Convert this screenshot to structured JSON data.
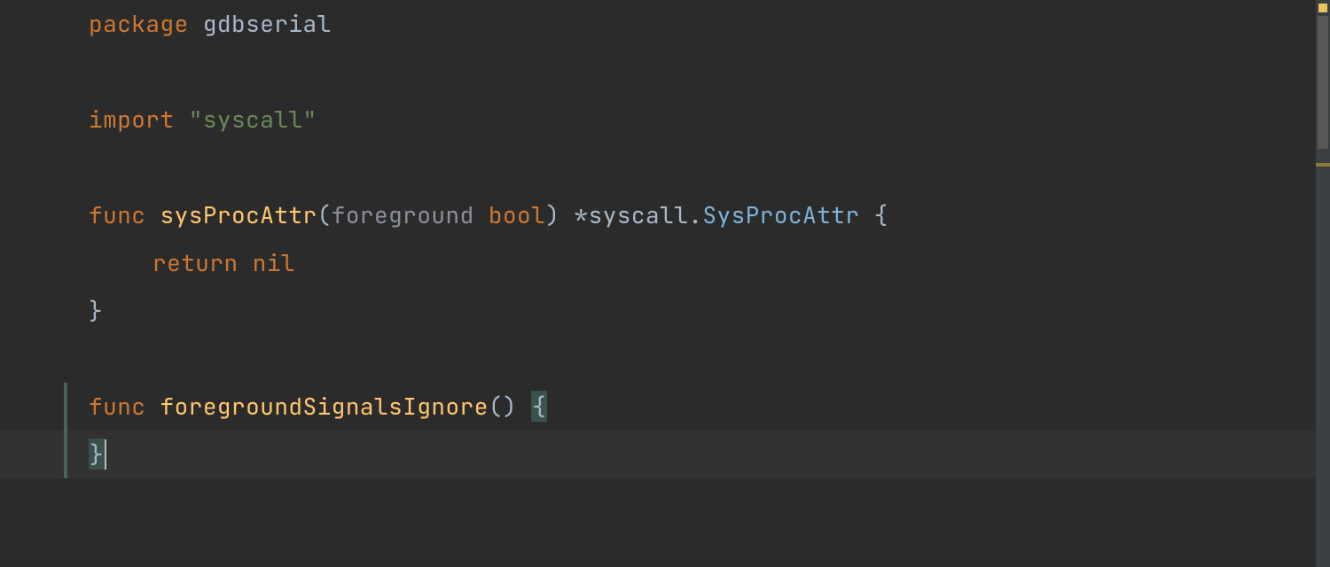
{
  "code": {
    "line1": {
      "kw_package": "package",
      "pkg_name": "gdbserial"
    },
    "line3": {
      "kw_import": "import",
      "import_path": "\"syscall\""
    },
    "line5": {
      "kw_func": "func",
      "fn_name": "sysProcAttr",
      "paren_open": "(",
      "param_name": "foreground",
      "param_type": "bool",
      "paren_close": ")",
      "star": "*",
      "ret_pkg": "syscall",
      "dot": ".",
      "ret_type": "SysProcAttr",
      "brace_open": "{"
    },
    "line6": {
      "kw_return": "return",
      "kw_nil": "nil"
    },
    "line7": {
      "brace_close": "}"
    },
    "line9": {
      "kw_func": "func",
      "fn_name": "foregroundSignalsIgnore",
      "parens": "()",
      "brace_open": "{"
    },
    "line10": {
      "brace_close": "}"
    }
  },
  "colors": {
    "background": "#2b2b2b",
    "keyword": "#cc7832",
    "identifier": "#a9b7c6",
    "function": "#ffc66d",
    "string": "#6a8759",
    "parameter": "#8a8f99",
    "type": "#7eb2d6",
    "current_line": "#323232",
    "brace_match": "#3b514d",
    "warning_marker": "#e8c35b"
  }
}
